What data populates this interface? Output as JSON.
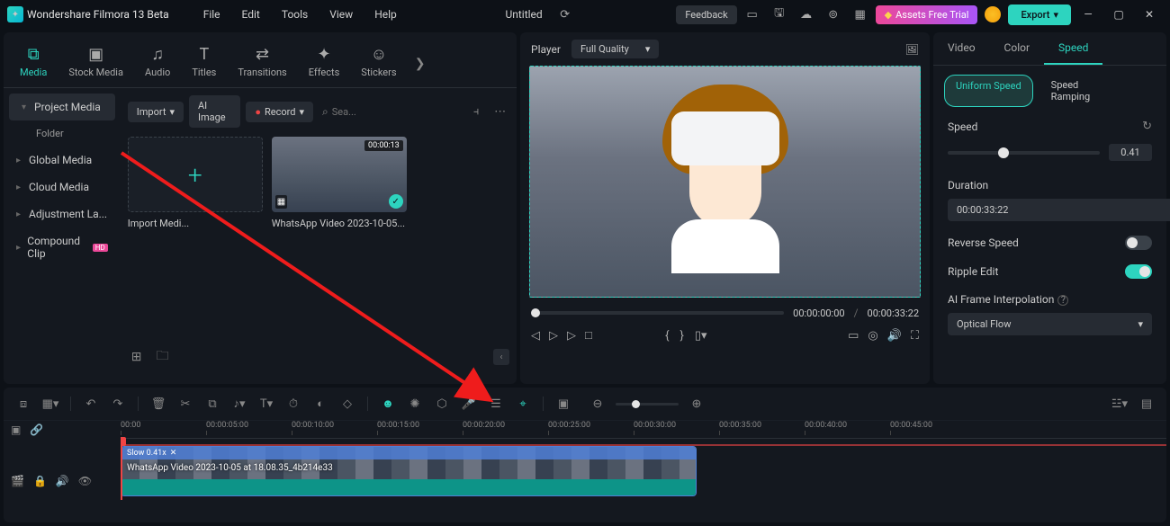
{
  "app": {
    "title": "Wondershare Filmora 13 Beta"
  },
  "menu": [
    "File",
    "Edit",
    "Tools",
    "View",
    "Help"
  ],
  "document": {
    "title": "Untitled"
  },
  "titlebar": {
    "feedback": "Feedback",
    "assets": "Assets Free Trial",
    "export": "Export"
  },
  "categories": [
    {
      "label": "Media",
      "active": true
    },
    {
      "label": "Stock Media"
    },
    {
      "label": "Audio"
    },
    {
      "label": "Titles"
    },
    {
      "label": "Transitions"
    },
    {
      "label": "Effects"
    },
    {
      "label": "Stickers"
    }
  ],
  "media_sidebar": {
    "project_media": "Project Media",
    "folder": "Folder",
    "global_media": "Global Media",
    "cloud_media": "Cloud Media",
    "adjustment": "Adjustment La...",
    "compound": "Compound Clip"
  },
  "media_toolbar": {
    "import": "Import",
    "ai_image": "AI Image",
    "record": "Record",
    "search_placeholder": "Sea..."
  },
  "media_cards": {
    "import_label": "Import Medi...",
    "video_label": "WhatsApp Video 2023-10-05...",
    "video_duration": "00:00:13"
  },
  "preview": {
    "player": "Player",
    "quality": "Full Quality",
    "time_current": "00:00:00:00",
    "time_total": "00:00:33:22"
  },
  "props": {
    "tabs": [
      "Video",
      "Color",
      "Speed"
    ],
    "subtabs": [
      "Uniform Speed",
      "Speed Ramping"
    ],
    "speed_label": "Speed",
    "speed_value": "0.41",
    "duration_label": "Duration",
    "duration_value": "00:00:33:22",
    "reverse_label": "Reverse Speed",
    "ripple_label": "Ripple Edit",
    "ai_frame_label": "AI Frame Interpolation",
    "ai_option": "Optical Flow"
  },
  "timeline": {
    "marks": [
      "00:00",
      "00:00:05:00",
      "00:00:10:00",
      "00:00:15:00",
      "00:00:20:00",
      "00:00:25:00",
      "00:00:30:00",
      "00:00:35:00",
      "00:00:40:00",
      "00:00:45:00"
    ],
    "clip_speed_label": "Slow 0.41x",
    "clip_name": "WhatsApp Video 2023-10-05 at 18.08.35_4b214e33"
  }
}
